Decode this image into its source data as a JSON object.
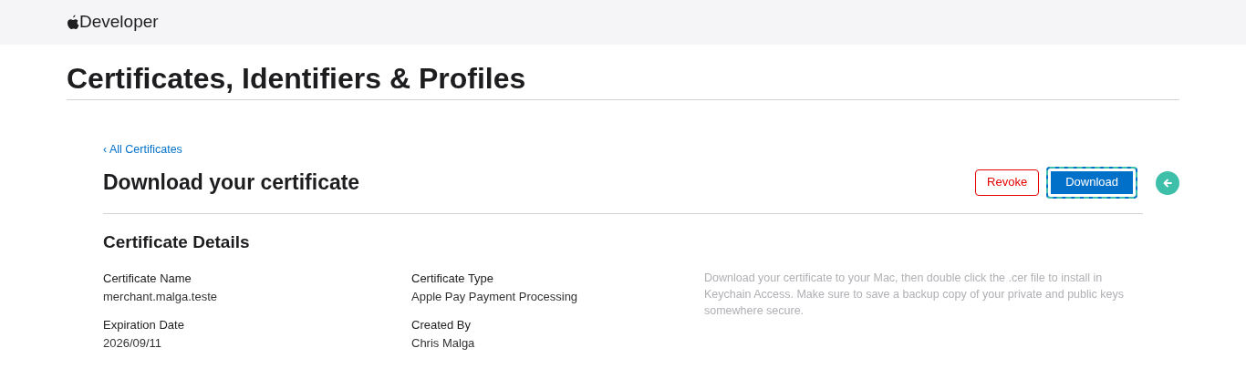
{
  "header": {
    "brand": "Developer"
  },
  "page_title": "Certificates, Identifiers & Profiles",
  "back_link": "‹ All Certificates",
  "heading": "Download your certificate",
  "buttons": [
    {
      "label": "Revoke",
      "kind": "danger",
      "focused": false
    },
    {
      "label": "Download",
      "kind": "primary",
      "focused": true
    }
  ],
  "section_title": "Certificate Details",
  "details": [
    {
      "label": "Certificate Name",
      "value": "merchant.malga.teste"
    },
    {
      "label": "Certificate Type",
      "value": "Apple Pay Payment Processing"
    },
    {
      "label": "Expiration Date",
      "value": "2026/09/11"
    },
    {
      "label": "Created By",
      "value": "Chris Malga"
    }
  ],
  "note": "Download your certificate to your Mac, then double click the .cer file to install in Keychain Access. Make sure to save a backup copy of your private and public keys somewhere secure."
}
